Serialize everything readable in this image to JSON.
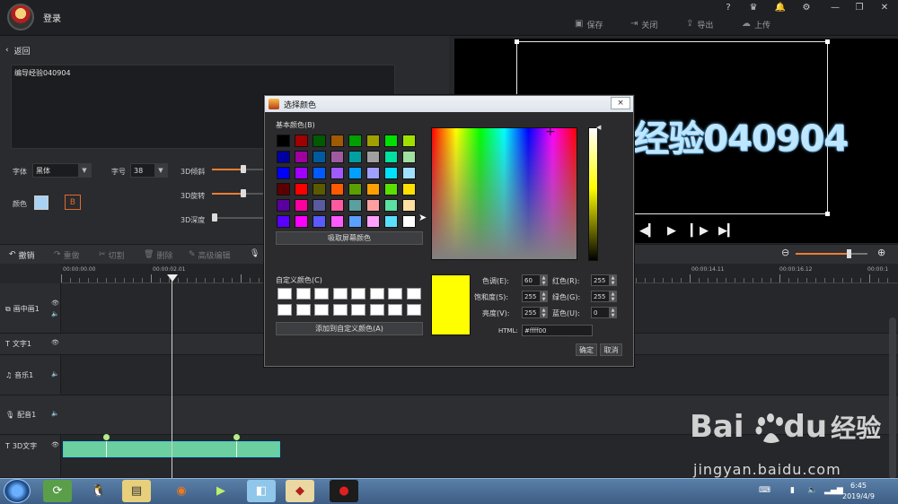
{
  "app": {
    "login_label": "登录",
    "window_icons": [
      "help-icon",
      "vip-icon",
      "notify-icon",
      "settings-icon",
      "minimize-icon",
      "restore-icon",
      "close-icon"
    ],
    "toolbar": {
      "save": "保存",
      "close": "关闭",
      "export": "导出",
      "upload": "上传"
    }
  },
  "left_panel": {
    "back": "返回",
    "text_value": "编导经验040904",
    "font_label": "字体",
    "font_value": "黑体",
    "size_label": "字号",
    "size_value": "38",
    "color_label": "颜色",
    "bold_label": "B",
    "sliders": [
      {
        "label": "3D倾斜",
        "value": 0.6
      },
      {
        "label": "3D旋转",
        "value": 0.6
      },
      {
        "label": "3D深度",
        "value": 0.05
      }
    ]
  },
  "preview": {
    "text": "经验040904"
  },
  "edit_toolbar": {
    "undo": "撤销",
    "redo": "重做",
    "cut": "切割",
    "delete": "删除",
    "advanced": "高级编辑"
  },
  "timeline": {
    "times": [
      "00:00:00.00",
      "00:00:02.01",
      "00:00:14.11",
      "00:00:16.12",
      "00:00:1"
    ],
    "tracks": [
      {
        "name": "画中画1",
        "icon": "pip-icon"
      },
      {
        "name": "文字1",
        "icon": "text-icon"
      },
      {
        "name": "音乐1",
        "icon": "music-icon"
      },
      {
        "name": "配音1",
        "icon": "mic-icon"
      },
      {
        "name": "3D文字",
        "icon": "text-icon"
      }
    ]
  },
  "dialog": {
    "title": "选择颜色",
    "close": "×",
    "basic_label": "基本颜色(B)",
    "basic_colors": [
      "#000000",
      "#a00000",
      "#005a00",
      "#a05a00",
      "#00a000",
      "#a0a000",
      "#00e000",
      "#a0e000",
      "#0000a0",
      "#a000a0",
      "#005aa0",
      "#a05aa0",
      "#00a0a0",
      "#a0a0a0",
      "#00e0a0",
      "#a0e0a0",
      "#0000ff",
      "#a000ff",
      "#005aff",
      "#a05aff",
      "#00a0ff",
      "#a0a0ff",
      "#00e0ff",
      "#a0e0ff",
      "#5a0000",
      "#ff0000",
      "#5a5a00",
      "#ff5a00",
      "#5aa000",
      "#ffa000",
      "#5ae000",
      "#ffe000",
      "#5a00a0",
      "#ff00a0",
      "#5a5aa0",
      "#ff5aa0",
      "#5aa0a0",
      "#ffa0a0",
      "#5ae0a0",
      "#ffe0a0",
      "#5a00ff",
      "#ff00ff",
      "#5a5aff",
      "#ff5aff",
      "#5aa0ff",
      "#ffa0ff",
      "#5ae0ff",
      "#ffffff"
    ],
    "pick_screen": "吸取屏幕颜色",
    "custom_label": "自定义颜色(C)",
    "add_custom": "添加到自定义颜色(A)",
    "fields": {
      "hue_label": "色调(E):",
      "hue": "60",
      "sat_label": "饱和度(S):",
      "sat": "255",
      "lum_label": "亮度(V):",
      "lum": "255",
      "red_label": "红色(R):",
      "red": "255",
      "green_label": "绿色(G):",
      "green": "255",
      "blue_label": "蓝色(U):",
      "blue": "0",
      "html_label": "HTML:",
      "html": "#ffff00"
    },
    "ok": "确定",
    "cancel": "取消",
    "current_color": "#ffff00"
  },
  "taskbar": {
    "time": "6:45",
    "date": "2019/4/9"
  },
  "watermark": {
    "brand": "Bai",
    "brand2": "du",
    "jy": "经验",
    "url": "jingyan.baidu.com"
  }
}
